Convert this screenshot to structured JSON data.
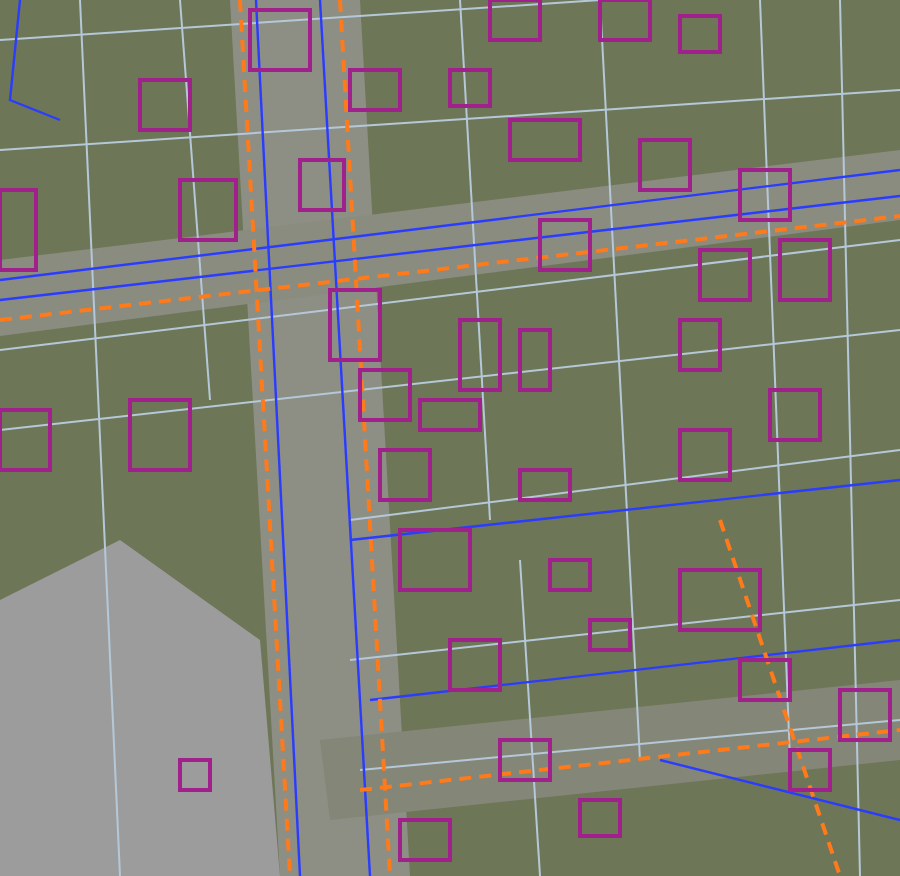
{
  "map": {
    "layers": [
      {
        "kind": "parcels",
        "color": "#b4c8d8"
      },
      {
        "kind": "utilities",
        "color": "#2a3cff"
      },
      {
        "kind": "boundaries",
        "color": "#ff7a1a"
      },
      {
        "kind": "buildings",
        "color": "#a0208c"
      }
    ]
  }
}
